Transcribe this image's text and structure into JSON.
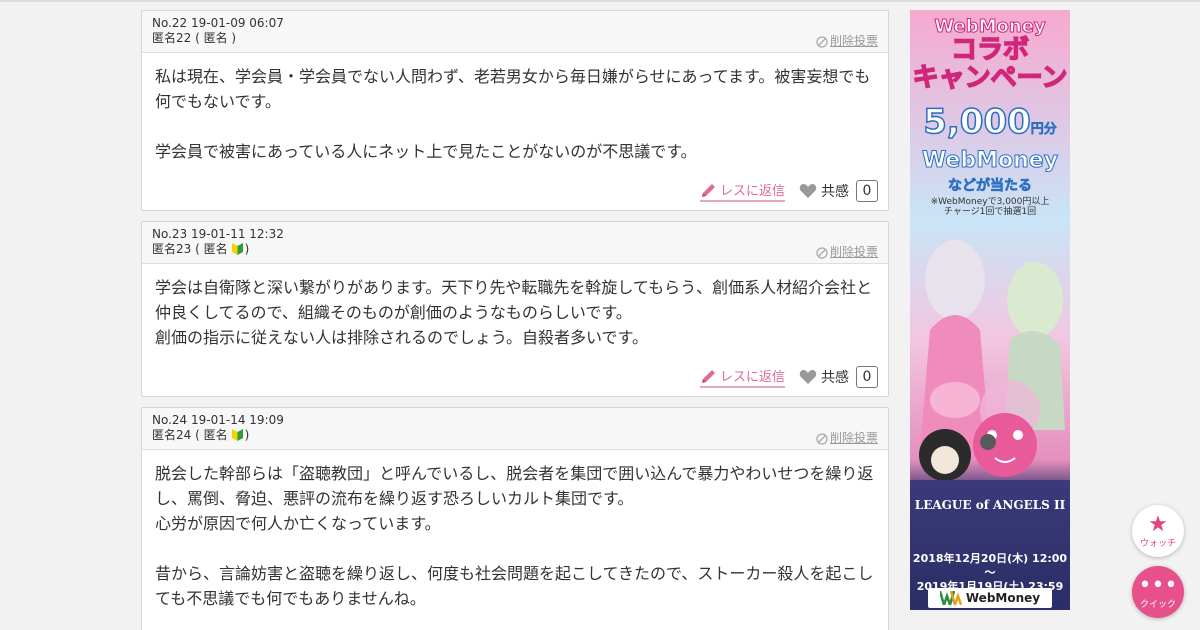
{
  "posts": [
    {
      "meta": "No.22 19-01-09 06:07",
      "author": "匿名22 ( 匿名 )",
      "beginner": false,
      "delete_label": "削除投票",
      "body": "私は現在、学会員・学会員でない人問わず、老若男女から毎日嫌がらせにあってます。被害妄想でも何でもないです。\n\n学会員で被害にあっている人にネット上で見たことがないのが不思議です。",
      "reply_label": "レスに返信",
      "like_label": "共感",
      "like_count": "0"
    },
    {
      "meta": "No.23 19-01-11 12:32",
      "author_prefix": "匿名23 ( 匿名",
      "author_suffix": ")",
      "beginner": true,
      "delete_label": "削除投票",
      "body": "学会は自衛隊と深い繋がりがあります。天下り先や転職先を斡旋してもらう、創価系人材紹介会社と仲良くしてるので、組織そのものが創価のようなものらしいです。\n創価の指示に従えない人は排除されるのでしょう。自殺者多いです。",
      "reply_label": "レスに返信",
      "like_label": "共感",
      "like_count": "0"
    },
    {
      "meta": "No.24 19-01-14 19:09",
      "author_prefix": "匿名24 ( 匿名",
      "author_suffix": ")",
      "beginner": true,
      "delete_label": "削除投票",
      "body": "脱会した幹部らは「盗聴教団」と呼んでいるし、脱会者を集団で囲い込んで暴力やわいせつを繰り返し、罵倒、脅迫、悪評の流布を繰り返す恐ろしいカルト集団です。\n心労が原因で何人か亡くなっています。\n\n昔から、言論妨害と盗聴を繰り返し、何度も社会問題を起こしてきたので、ストーカー殺人を起こしても不思議でも何でもありませんね。"
    }
  ],
  "ad": {
    "title1": "WebMoney",
    "title2a": "コラボ",
    "title2b": "キャンペーン",
    "amount": "5,000",
    "amount_unit": "円分",
    "brand_line": "WebMoney",
    "win_line": "などが当たる",
    "note": "※WebMoneyで3,000円以上\nチャージ1回で抽選1回",
    "collab": "LEAGUE of ANGELS II",
    "dates": "2018年12月20日(木) 12:00～\n2019年1月19日(土) 23:59",
    "footer_brand": "WebMoney"
  },
  "fabs": {
    "watch_label": "ウォッチ",
    "quick_label": "クイック"
  },
  "colors": {
    "accent_pink": "#e0699a",
    "fab_pink": "#e8508b",
    "background": "#f2f2f2"
  }
}
